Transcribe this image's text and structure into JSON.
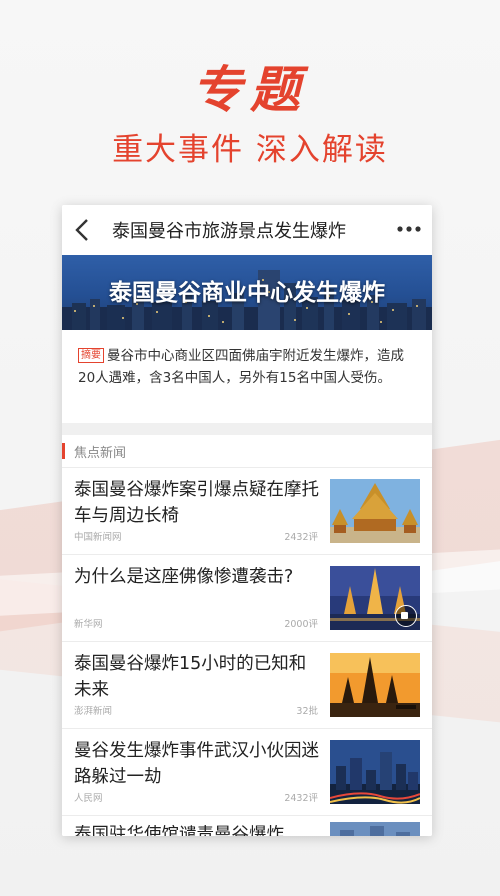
{
  "hero": {
    "title": "专题",
    "subtitle": "重大事件 深入解读"
  },
  "nav": {
    "back_icon": "chevron-left-icon",
    "title": "泰国曼谷市旅游景点发生爆炸",
    "more_icon": "more-dots-icon"
  },
  "banner": {
    "title": "泰国曼谷商业中心发生爆炸"
  },
  "summary": {
    "tag": "摘要",
    "text": "曼谷市中心商业区四面佛庙宇附近发生爆炸，造成20人遇难，含3名中国人，另外有15名中国人受伤。"
  },
  "section": {
    "label": "焦点新闻"
  },
  "news": [
    {
      "title": "泰国曼谷爆炸案引爆点疑在摩托车与周边长椅",
      "source": "中国新闻网",
      "count": "2432评",
      "thumb": "temple-icon"
    },
    {
      "title": "为什么是这座佛像惨遭袭击?",
      "source": "新华网",
      "count": "2000评",
      "thumb": "pagoda-night-icon",
      "video": true
    },
    {
      "title": "泰国曼谷爆炸15小时的已知和未来",
      "source": "澎湃新闻",
      "count": "32批",
      "thumb": "temple-sunset-icon"
    },
    {
      "title": "曼谷发生爆炸事件武汉小伙因迷路躲过一劫",
      "source": "人民网",
      "count": "2432评",
      "thumb": "city-night-icon"
    },
    {
      "title": "泰国驻华使馆谴责曼谷爆炸",
      "source": "",
      "count": "",
      "thumb": "city-icon"
    }
  ],
  "colors": {
    "accent": "#e4432e",
    "banner_blue": "#2f5fa8"
  }
}
